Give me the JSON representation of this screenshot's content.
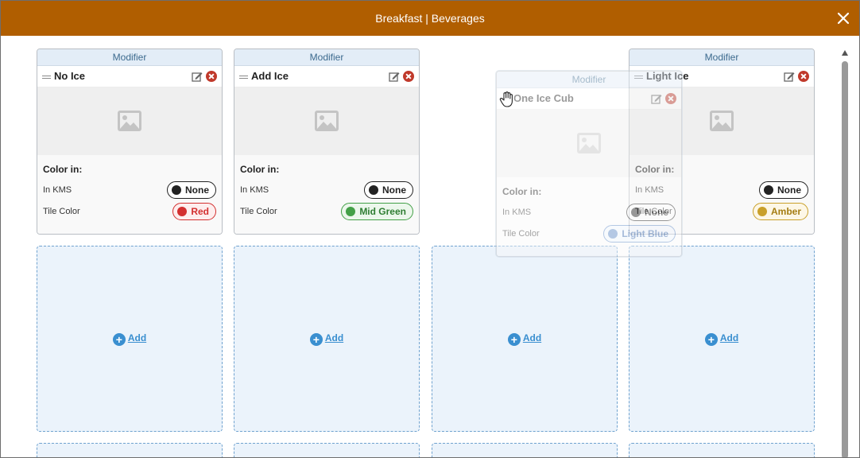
{
  "dialog": {
    "title": "Breakfast | Beverages"
  },
  "common": {
    "header": "Modifier",
    "color_in": "Color in:",
    "in_kms": "In KMS",
    "tile_color": "Tile Color",
    "add": "Add"
  },
  "cards": [
    {
      "name": "No Ice",
      "kms": "None",
      "tile": "Red"
    },
    {
      "name": "Add Ice",
      "kms": "None",
      "tile": "Mid Green"
    },
    {
      "name": "Light Ice",
      "kms": "None",
      "tile": "Amber"
    }
  ],
  "dragging": {
    "name": "One Ice Cub",
    "kms": "None",
    "tile": "Light Blue"
  },
  "colors": {
    "titlebar": "#b05e00",
    "none": "#222222",
    "red": "#d32f2f",
    "mid_green": "#43a047",
    "amber": "#c9a02a",
    "light_blue": "#90b4e0",
    "add": "#3a8fd0"
  }
}
